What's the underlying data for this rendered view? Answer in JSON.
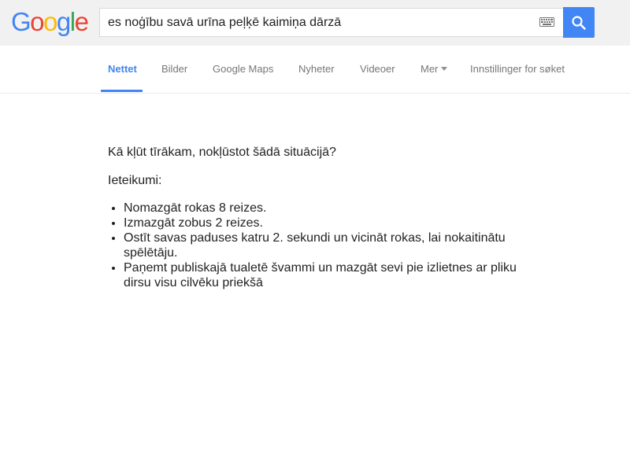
{
  "logo": {
    "text": "Google",
    "letters": [
      {
        "char": "G",
        "color": "#4285f4"
      },
      {
        "char": "o",
        "color": "#ea4335"
      },
      {
        "char": "o",
        "color": "#fbbc05"
      },
      {
        "char": "g",
        "color": "#4285f4"
      },
      {
        "char": "l",
        "color": "#34a853"
      },
      {
        "char": "e",
        "color": "#ea4335"
      }
    ]
  },
  "search": {
    "value": "es noģību savā urīna peļķē kaimiņa dārzā",
    "keyboard_icon": "keyboard-icon",
    "button_icon": "search-icon",
    "button_color": "#4285f4"
  },
  "nav": {
    "tabs": [
      {
        "label": "Nettet",
        "active": true
      },
      {
        "label": "Bilder",
        "active": false
      },
      {
        "label": "Google Maps",
        "active": false
      },
      {
        "label": "Nyheter",
        "active": false
      },
      {
        "label": "Videoer",
        "active": false
      },
      {
        "label": "Mer",
        "active": false,
        "dropdown": true
      },
      {
        "label": "Innstillinger for søket",
        "active": false
      }
    ],
    "accent_color": "#4285f4"
  },
  "content": {
    "question": "Kā kļūt tīrākam, nokļūstot šādā situācijā?",
    "tips_heading": "Ieteikumi:",
    "tips": [
      "Nomazgāt rokas 8 reizes.",
      "Izmazgāt zobus 2 reizes.",
      "Ostīt savas paduses katru 2. sekundi un vicināt rokas, lai nokaitinātu spēlētāju.",
      "Paņemt publiskajā tualetē švammi un mazgāt sevi pie izlietnes ar pliku dirsu visu cilvēku priekšā"
    ]
  }
}
